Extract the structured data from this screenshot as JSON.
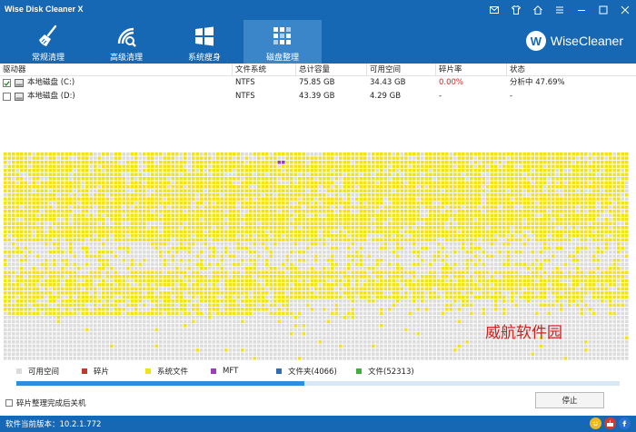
{
  "app": {
    "title": "Wise Disk Cleaner X"
  },
  "window_controls": [
    {
      "icon": "mail-icon"
    },
    {
      "icon": "shirt-icon"
    },
    {
      "icon": "home-icon"
    },
    {
      "icon": "menu-icon"
    },
    {
      "icon": "minimize-icon"
    },
    {
      "icon": "maximize-icon"
    },
    {
      "icon": "close-icon"
    }
  ],
  "nav": {
    "tabs": [
      {
        "label": "常规清理",
        "icon": "broom-icon",
        "active": false
      },
      {
        "label": "高级清理",
        "icon": "deep-scan-icon",
        "active": false
      },
      {
        "label": "系统瘦身",
        "icon": "windows-icon",
        "active": false
      },
      {
        "label": "磁盘整理",
        "icon": "defrag-icon",
        "active": true
      }
    ]
  },
  "brand": {
    "logo_letter": "W",
    "name": "WiseCleaner"
  },
  "table": {
    "headers": [
      "驱动器",
      "文件系统",
      "总计容量",
      "可用空间",
      "碎片率",
      "状态"
    ],
    "rows": [
      {
        "checked": true,
        "drive": "本地磁盘 (C:)",
        "fs": "NTFS",
        "total": "75.85 GB",
        "free": "34.43 GB",
        "frag": "0.00%",
        "status": "分析中 47.69%"
      },
      {
        "checked": false,
        "drive": "本地磁盘 (D:)",
        "fs": "NTFS",
        "total": "43.39 GB",
        "free": "4.29 GB",
        "frag": "-",
        "status": "-"
      }
    ]
  },
  "legend": [
    {
      "label": "可用空间",
      "color": "#dcdcdc"
    },
    {
      "label": "碎片",
      "color": "#c0392b"
    },
    {
      "label": "系统文件",
      "color": "#f2e21a"
    },
    {
      "label": "MFT",
      "color": "#9b3fbf"
    },
    {
      "label": "文件夹(4066)",
      "color": "#2f6db5"
    },
    {
      "label": "文件(52313)",
      "color": "#3fae3f"
    }
  ],
  "progress": {
    "percent": 47.69
  },
  "options": {
    "shutdown_label": "碎片整理完成后关机",
    "shutdown_checked": false
  },
  "buttons": {
    "stop_label": "停止"
  },
  "watermark": "威航软件园",
  "status_bar": {
    "version": "软件当前版本：10.2.1.772"
  },
  "colors": {
    "accent": "#1668b4",
    "free": "#dcdcdc",
    "system": "#f2e21a",
    "mft": "#9b3fbf"
  }
}
